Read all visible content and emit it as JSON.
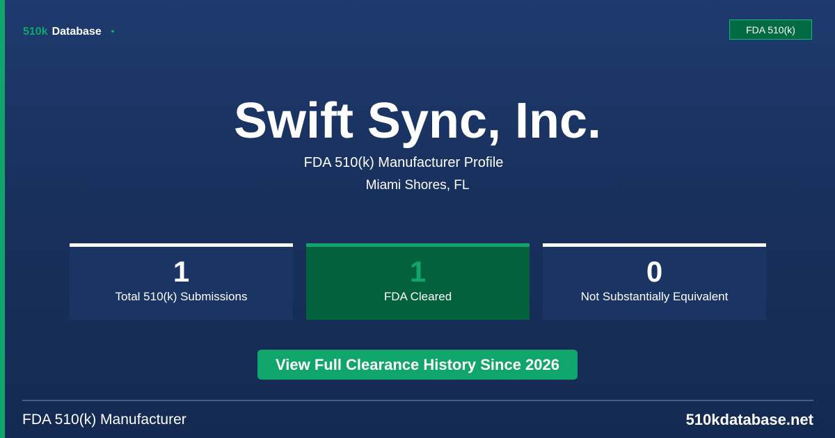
{
  "brand": {
    "highlight": "510k",
    "name": "Database"
  },
  "badge": "FDA 510(k)",
  "company": {
    "name": "Swift Sync, Inc.",
    "subtitle": "FDA 510(k) Manufacturer Profile",
    "location": "Miami Shores, FL"
  },
  "stats": [
    {
      "value": "1",
      "label": "Total 510(k) Submissions"
    },
    {
      "value": "1",
      "label": "FDA Cleared"
    },
    {
      "value": "0",
      "label": "Not Substantially Equivalent"
    }
  ],
  "cta": "View Full Clearance History Since 2026",
  "footer": {
    "left": "FDA 510(k) Manufacturer",
    "right": "510kdatabase.net"
  },
  "colors": {
    "accent": "#0fa56b",
    "background": "#1b3668",
    "card": "#1a3463",
    "card_highlight": "#03623d"
  }
}
